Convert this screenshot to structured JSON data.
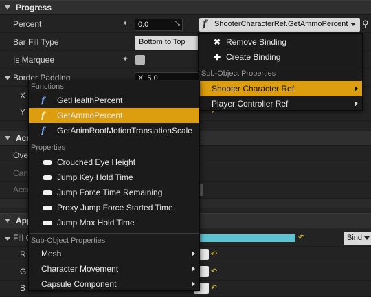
{
  "progress_section": {
    "title": "Progress"
  },
  "rows": {
    "percent": {
      "label": "Percent",
      "value": "0.0",
      "binding": "ShooterCharacterRef.GetAmmoPercent"
    },
    "bar_fill_type": {
      "label": "Bar Fill Type",
      "value": "Bottom to Top"
    },
    "is_marquee": {
      "label": "Is Marquee"
    },
    "border_padding": {
      "label": "Border Padding",
      "x_label": "X",
      "x_value": "5.0"
    },
    "x": {
      "label": "X"
    },
    "y": {
      "label": "Y"
    }
  },
  "sections": {
    "accessibility": "Acce",
    "override": "Over",
    "can": "Can",
    "acce2": "Acce",
    "appearance": "Appe",
    "fill_color": "Fill C",
    "r": "R",
    "g": "G",
    "b": "B"
  },
  "bind_button": "Bind",
  "binding_menu": {
    "remove": "Remove Binding",
    "create": "Create Binding",
    "header": "Sub-Object Properties",
    "items": [
      "Shooter Character Ref",
      "Player Controller Ref"
    ]
  },
  "function_menu": {
    "functions_header": "Functions",
    "functions": [
      "GetHealthPercent",
      "GetAmmoPercent",
      "GetAnimRootMotionTranslationScale"
    ],
    "properties_header": "Properties",
    "properties": [
      "Crouched Eye Height",
      "Jump Key Hold Time",
      "Jump Force Time Remaining",
      "Proxy Jump Force Started Time",
      "Jump Max Hold Time"
    ],
    "subobjects_header": "Sub-Object Properties",
    "subobjects": [
      "Mesh",
      "Character Movement",
      "Capsule Component"
    ]
  },
  "colors": {
    "accent": "#dc9d0e",
    "fill_bar": "#5ec2d0"
  }
}
